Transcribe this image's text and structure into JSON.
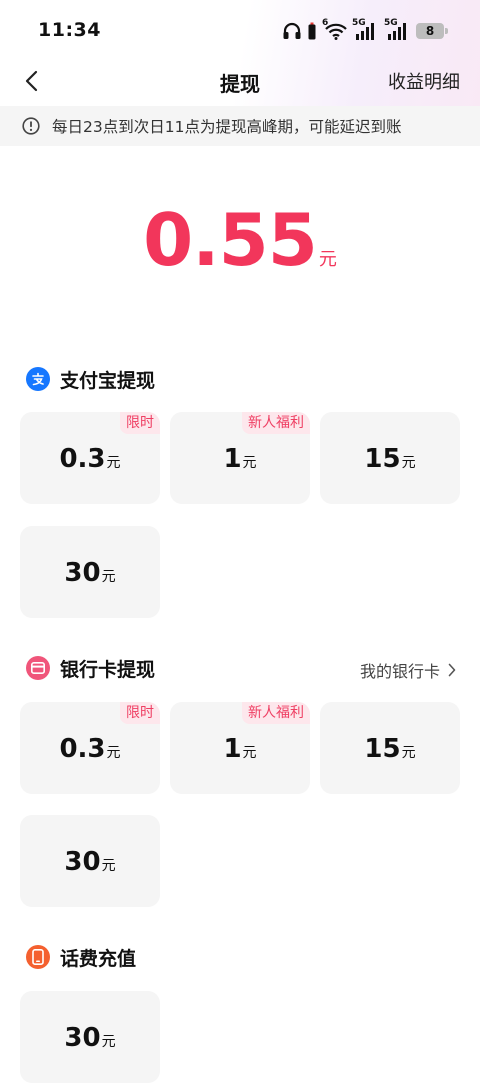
{
  "status_bar": {
    "time": "11:34",
    "battery_level": "8",
    "network_1": "5G",
    "network_2": "5G",
    "wifi_badge": "6"
  },
  "nav": {
    "title": "提现",
    "right_label": "收益明细"
  },
  "notice": {
    "text": "每日23点到次日11点为提现高峰期，可能延迟到账"
  },
  "balance": {
    "amount": "0.55",
    "unit": "元"
  },
  "sections": {
    "alipay": {
      "title": "支付宝提现",
      "options": [
        {
          "value": "0.3",
          "unit": "元",
          "tag": "限时"
        },
        {
          "value": "1",
          "unit": "元",
          "tag": "新人福利"
        },
        {
          "value": "15",
          "unit": "元",
          "tag": ""
        },
        {
          "value": "30",
          "unit": "元",
          "tag": ""
        }
      ]
    },
    "bank": {
      "title": "银行卡提现",
      "link": "我的银行卡",
      "options": [
        {
          "value": "0.3",
          "unit": "元",
          "tag": "限时"
        },
        {
          "value": "1",
          "unit": "元",
          "tag": "新人福利"
        },
        {
          "value": "15",
          "unit": "元",
          "tag": ""
        },
        {
          "value": "30",
          "unit": "元",
          "tag": ""
        }
      ]
    },
    "phone": {
      "title": "话费充值",
      "options": [
        {
          "value": "30",
          "unit": "元",
          "tag": ""
        }
      ]
    }
  },
  "colors": {
    "accent": "#f2365b",
    "alipay_blue": "#1677ff",
    "bank_pink": "#f0557a",
    "phone_orange": "#f4602f"
  },
  "icons": {
    "back": "chevron-left-icon",
    "notice": "info-circle-icon",
    "alipay": "alipay-icon",
    "bank": "bank-card-icon",
    "phone": "phone-icon",
    "link_arrow": "chevron-right-icon"
  }
}
